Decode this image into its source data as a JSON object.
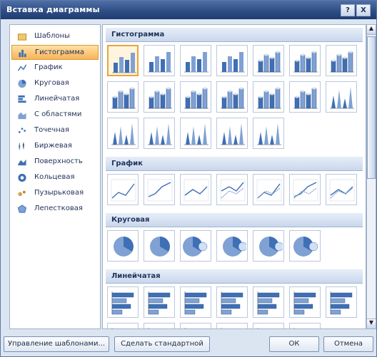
{
  "dialog": {
    "title": "Вставка диаграммы",
    "help_label": "?",
    "close_label": "X"
  },
  "sidebar": {
    "items": [
      {
        "label": "Шаблоны",
        "icon": "folder-icon",
        "selected": false
      },
      {
        "label": "Гистограмма",
        "icon": "column-chart-icon",
        "selected": true
      },
      {
        "label": "График",
        "icon": "line-chart-icon",
        "selected": false
      },
      {
        "label": "Круговая",
        "icon": "pie-chart-icon",
        "selected": false
      },
      {
        "label": "Линейчатая",
        "icon": "bar-chart-icon",
        "selected": false
      },
      {
        "label": "С областями",
        "icon": "area-chart-icon",
        "selected": false
      },
      {
        "label": "Точечная",
        "icon": "scatter-chart-icon",
        "selected": false
      },
      {
        "label": "Биржевая",
        "icon": "stock-chart-icon",
        "selected": false
      },
      {
        "label": "Поверхность",
        "icon": "surface-chart-icon",
        "selected": false
      },
      {
        "label": "Кольцевая",
        "icon": "doughnut-chart-icon",
        "selected": false
      },
      {
        "label": "Пузырьковая",
        "icon": "bubble-chart-icon",
        "selected": false
      },
      {
        "label": "Лепестковая",
        "icon": "radar-chart-icon",
        "selected": false
      }
    ]
  },
  "gallery": {
    "sections": [
      {
        "title": "Гистограмма",
        "kind": "column",
        "count": 19
      },
      {
        "title": "График",
        "kind": "line",
        "count": 7
      },
      {
        "title": "Круговая",
        "kind": "pie",
        "count": 6
      },
      {
        "title": "Линейчатая",
        "kind": "bar",
        "count": 13
      }
    ]
  },
  "footer": {
    "manage_label": "Управление шаблонами...",
    "set_default_label": "Сделать стандартной",
    "ok_label": "ОК",
    "cancel_label": "Отмена"
  },
  "colors": {
    "accent": "#3f6fb5",
    "accent_light": "#7fa1d4",
    "selection": "#f9b35a"
  }
}
